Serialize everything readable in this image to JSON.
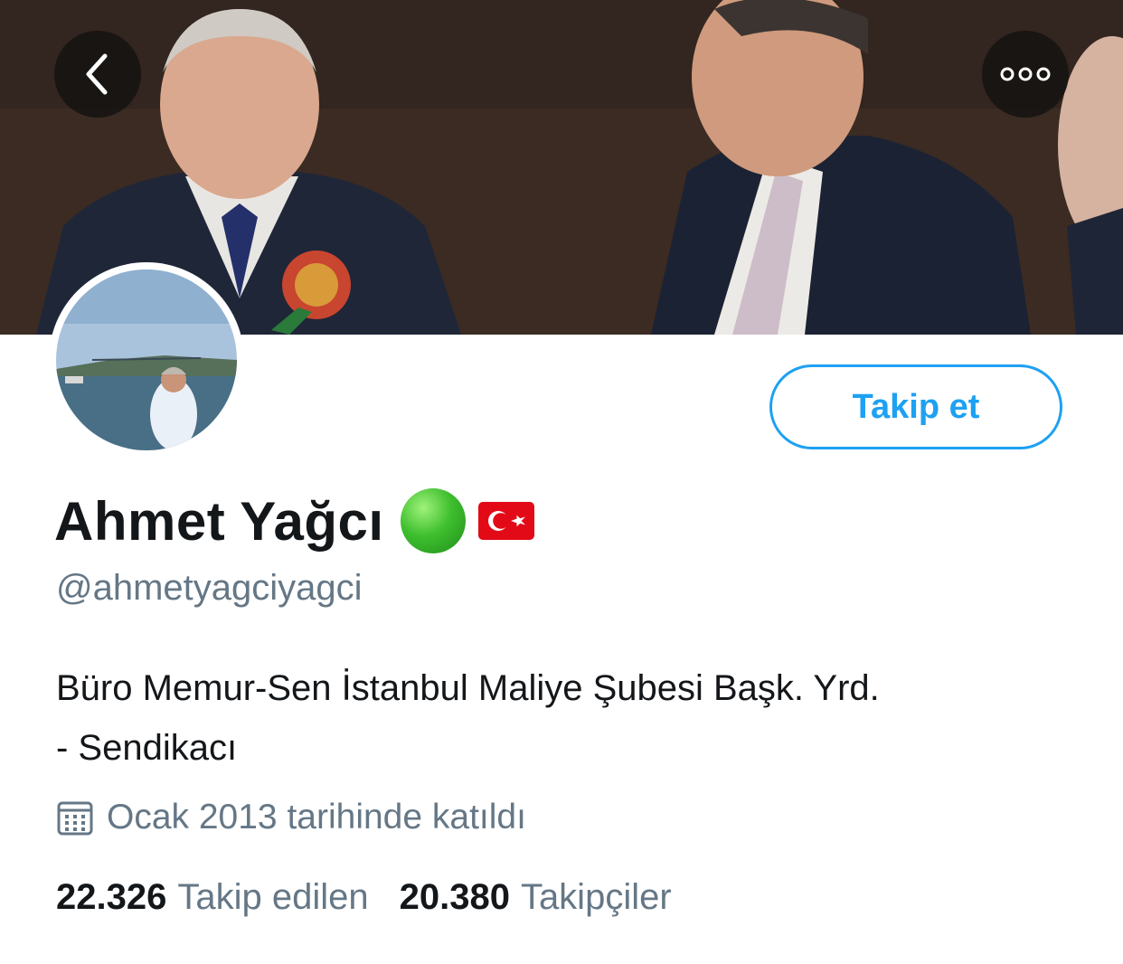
{
  "banner": {
    "icon": "header-photo"
  },
  "nav": {
    "back_icon": "chevron-left-icon",
    "more_icon": "more-horizontal-icon"
  },
  "profile": {
    "avatar_icon": "profile-photo",
    "display_name": "Ahmet Yağcı",
    "name_emojis": [
      "green-circle-emoji",
      "turkey-flag-emoji"
    ],
    "handle": "@ahmetyagciyagci",
    "bio_line1": "Büro Memur-Sen İstanbul Maliye Şubesi Başk. Yrd.",
    "bio_line2": "- Sendikacı",
    "joined_icon": "calendar-icon",
    "joined_text": "Ocak 2013 tarihinde katıldı"
  },
  "actions": {
    "follow_label": "Takip et"
  },
  "stats": {
    "following_count": "22.326",
    "following_label": "Takip edilen",
    "followers_count": "20.380",
    "followers_label": "Takipçiler"
  },
  "colors": {
    "accent": "#1da1f2",
    "secondary_text": "#657786",
    "primary_text": "#14171a"
  }
}
